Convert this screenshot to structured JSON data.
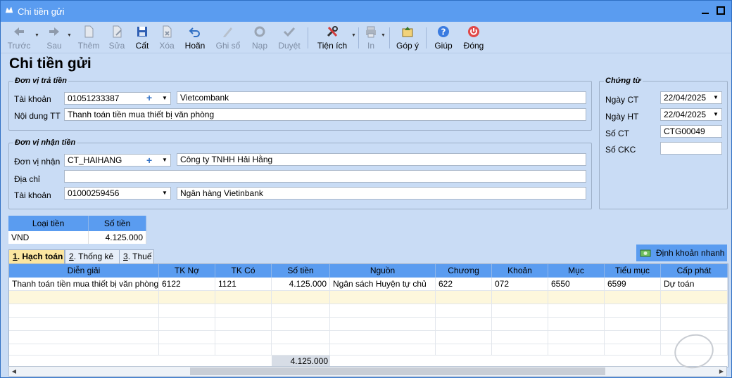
{
  "window": {
    "title": "Chi tiền gửi"
  },
  "toolbar": {
    "prev": "Trước",
    "next": "Sau",
    "add": "Thêm",
    "edit": "Sửa",
    "save": "Cất",
    "delete": "Xóa",
    "undo": "Hoãn",
    "post": "Ghi sổ",
    "load": "Nạp",
    "approve": "Duyệt",
    "utilities": "Tiện ích",
    "print": "In",
    "feedback": "Góp ý",
    "help": "Giúp",
    "close": "Đóng"
  },
  "page": {
    "title": "Chi tiền gửi"
  },
  "payer": {
    "legend": "Đơn vị trả tiền",
    "account_label": "Tài khoản",
    "account_value": "01051233387",
    "bank_name": "Vietcombank",
    "content_label": "Nội dung TT",
    "content_value": "Thanh toán tiền mua thiết bị văn phòng"
  },
  "payee": {
    "legend": "Đơn vị nhận tiền",
    "unit_label": "Đơn vị nhận",
    "unit_value": "CT_HAIHANG",
    "unit_name": "Công ty TNHH Hải Hằng",
    "address_label": "Địa chỉ",
    "address_value": "",
    "account_label": "Tài khoản",
    "account_value": "01000259456",
    "bank_name": "Ngân hàng Vietinbank"
  },
  "voucher": {
    "legend": "Chứng từ",
    "date_ct_label": "Ngày CT",
    "date_ct_value": "22/04/2025",
    "date_ht_label": "Ngày HT",
    "date_ht_value": "22/04/2025",
    "no_ct_label": "Số CT",
    "no_ct_value": "CTG00049",
    "no_ckc_label": "Số CKC",
    "no_ckc_value": ""
  },
  "currency": {
    "col_type": "Loại tiền",
    "col_amount": "Số tiền",
    "type": "VND",
    "amount": "4.125.000"
  },
  "tabs": {
    "t1_num": "1",
    "t1_label": ". Hạch toán",
    "t2_num": "2",
    "t2_label": ". Thống kê",
    "t3_num": "3",
    "t3_label": ". Thuế"
  },
  "quick_button": "Định khoản nhanh",
  "grid": {
    "headers": {
      "desc": "Diễn giải",
      "debit": "TK Nợ",
      "credit": "TK Có",
      "amount": "Số tiền",
      "source": "Nguồn",
      "chapter": "Chương",
      "item": "Khoản",
      "section": "Mục",
      "subsection": "Tiểu mục",
      "allocation": "Cấp phát"
    },
    "row1": {
      "desc": "Thanh toán tiền mua thiết bị văn phòng",
      "debit": "6122",
      "credit": "1121",
      "amount": "4.125.000",
      "source": "Ngân sách Huyện tự chủ",
      "chapter": "622",
      "item": "072",
      "section": "6550",
      "subsection": "6599",
      "allocation": "Dự toán"
    },
    "total_amount": "4.125.000"
  },
  "colors": {
    "accent": "#5a9cf0",
    "background": "#c9dcf5",
    "active_tab": "#fbe6a0"
  }
}
